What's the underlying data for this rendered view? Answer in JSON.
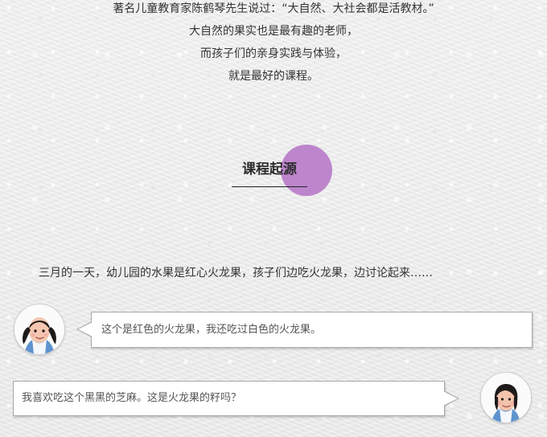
{
  "intro": {
    "lines": [
      "著名儿童教育家陈鹤琴先生说过：“大自然、大社会都是活教材。”",
      "大自然的果实也是最有趣的老师，",
      "而孩子们的亲身实践与体验，",
      "就是最好的课程。"
    ]
  },
  "section": {
    "title": "课程起源",
    "accent_color": "#bd85cc"
  },
  "story": {
    "text": "三月的一天，幼儿园的水果是红心火龙果，孩子们边吃火龙果，边讨论起来……"
  },
  "dialog": [
    {
      "side": "left",
      "avatar": "child-avatar-girl-pigtails",
      "text": "这个是红色的火龙果，我还吃过白色的火龙果。"
    },
    {
      "side": "right",
      "avatar": "child-avatar-girl-short-hair",
      "text": "我喜欢吃这个黑黑的芝麻。这是火龙果的籽吗？"
    }
  ]
}
